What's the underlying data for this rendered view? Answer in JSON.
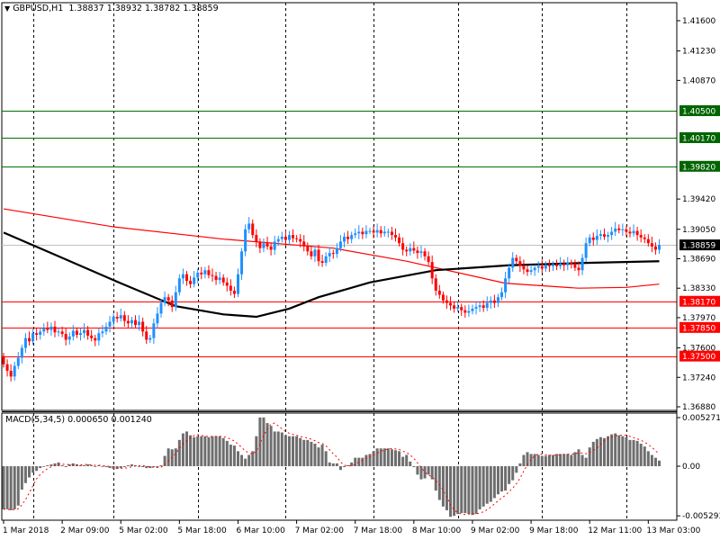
{
  "header": {
    "symbol": "GBPUSD,H1",
    "open": "1.38837",
    "high": "1.38932",
    "low": "1.38782",
    "close": "1.38859"
  },
  "macd_header": {
    "label": "MACD(5,34,5)",
    "main": "0.000650",
    "signal": "0.001240"
  },
  "colors": {
    "bull": "#1E90FF",
    "bear": "#FF0000",
    "support": "#FF0000",
    "resistance": "#007000",
    "badge_green": "#006400",
    "ma_fast": "#000000",
    "ma_slow": "#FF0000",
    "macd_hist": "#6E6E6E",
    "macd_signal": "#FF0000",
    "current_line": "#C0C0C0"
  },
  "chart_data": [
    {
      "type": "candlestick",
      "title": "GBPUSD,H1",
      "ylim": [
        1.3688,
        1.4195
      ],
      "first_open": 1.375,
      "closes": [
        1.374,
        1.3732,
        1.3725,
        1.3738,
        1.3748,
        1.376,
        1.3772,
        1.3768,
        1.3778,
        1.3776,
        1.378,
        1.3784,
        1.3782,
        1.3786,
        1.3779,
        1.378,
        1.3777,
        1.377,
        1.3774,
        1.3781,
        1.3776,
        1.3778,
        1.3782,
        1.3775,
        1.3772,
        1.3769,
        1.3778,
        1.378,
        1.3786,
        1.3792,
        1.3798,
        1.3796,
        1.38,
        1.3793,
        1.379,
        1.3794,
        1.3788,
        1.3792,
        1.378,
        1.377,
        1.3772,
        1.379,
        1.3802,
        1.3815,
        1.3822,
        1.3818,
        1.381,
        1.3828,
        1.3845,
        1.385,
        1.3842,
        1.3838,
        1.3846,
        1.3852,
        1.385,
        1.3855,
        1.3849,
        1.3848,
        1.3843,
        1.3846,
        1.384,
        1.3836,
        1.383,
        1.3826,
        1.385,
        1.3878,
        1.3905,
        1.3912,
        1.3898,
        1.389,
        1.3882,
        1.3888,
        1.3884,
        1.388,
        1.389,
        1.3893,
        1.3896,
        1.3892,
        1.3898,
        1.3894,
        1.3893,
        1.389,
        1.3884,
        1.3878,
        1.3872,
        1.388,
        1.3866,
        1.3864,
        1.3872,
        1.3876,
        1.3875,
        1.3882,
        1.389,
        1.3896,
        1.3893,
        1.3898,
        1.39,
        1.3902,
        1.3899,
        1.3903,
        1.3903,
        1.3901,
        1.3904,
        1.39,
        1.3902,
        1.3902,
        1.3898,
        1.3895,
        1.3888,
        1.388,
        1.3878,
        1.3882,
        1.3879,
        1.3876,
        1.3878,
        1.3872,
        1.3865,
        1.3845,
        1.383,
        1.3825,
        1.3818,
        1.3815,
        1.3812,
        1.3808,
        1.381,
        1.3806,
        1.3803,
        1.3805,
        1.3808,
        1.381,
        1.3812,
        1.3809,
        1.3815,
        1.3818,
        1.3815,
        1.3822,
        1.3828,
        1.3845,
        1.3858,
        1.387,
        1.3866,
        1.386,
        1.3856,
        1.3853,
        1.3855,
        1.3858,
        1.386,
        1.3857,
        1.3861,
        1.386,
        1.3862,
        1.386,
        1.3863,
        1.3861,
        1.3864,
        1.3862,
        1.3858,
        1.3855,
        1.387,
        1.3888,
        1.3895,
        1.3892,
        1.3897,
        1.3899,
        1.3896,
        1.3898,
        1.3902,
        1.3906,
        1.3904,
        1.3905,
        1.3902,
        1.39,
        1.3903,
        1.3898,
        1.3895,
        1.3893,
        1.3888,
        1.3884,
        1.388,
        1.38859
      ],
      "moving_averages": [
        {
          "name": "MA slow",
          "color": "#FF0000",
          "points": [
            [
              0,
              1.393
            ],
            [
              30,
              1.3908
            ],
            [
              60,
              1.3893
            ],
            [
              90,
              1.3882
            ],
            [
              110,
              1.3866
            ],
            [
              137,
              1.3839
            ],
            [
              157,
              1.3833
            ],
            [
              170,
              1.3834
            ],
            [
              179,
              1.3838
            ]
          ]
        },
        {
          "name": "MA fast",
          "color": "#000000",
          "points": [
            [
              0,
              1.3901
            ],
            [
              15,
              1.3872
            ],
            [
              32,
              1.3839
            ],
            [
              47,
              1.3811
            ],
            [
              60,
              1.3801
            ],
            [
              69,
              1.3798
            ],
            [
              78,
              1.3808
            ],
            [
              86,
              1.3822
            ],
            [
              100,
              1.384
            ],
            [
              118,
              1.3855
            ],
            [
              138,
              1.3861
            ],
            [
              160,
              1.3864
            ],
            [
              179,
              1.3866
            ]
          ]
        }
      ],
      "current_price": {
        "value": 1.38859,
        "label": "1.38859"
      },
      "levels": [
        {
          "value": 1.405,
          "label": "1.40500",
          "kind": "resistance"
        },
        {
          "value": 1.4017,
          "label": "1.40170",
          "kind": "resistance"
        },
        {
          "value": 1.3982,
          "label": "1.39820",
          "kind": "resistance"
        },
        {
          "value": 1.3817,
          "label": "1.38170",
          "kind": "support"
        },
        {
          "value": 1.3785,
          "label": "1.37850",
          "kind": "support"
        },
        {
          "value": 1.375,
          "label": "1.37500",
          "kind": "support"
        }
      ],
      "y_ticks": [
        {
          "value": 1.416,
          "label": "1.41600"
        },
        {
          "value": 1.4123,
          "label": "1.41230"
        },
        {
          "value": 1.4087,
          "label": "1.40870"
        },
        {
          "value": 1.3942,
          "label": "1.39420"
        },
        {
          "value": 1.3905,
          "label": "1.39050"
        },
        {
          "value": 1.3869,
          "label": "1.38690"
        },
        {
          "value": 1.3833,
          "label": "1.38330"
        },
        {
          "value": 1.3797,
          "label": "1.37970"
        },
        {
          "value": 1.376,
          "label": "1.37600"
        },
        {
          "value": 1.3724,
          "label": "1.37240"
        },
        {
          "value": 1.3688,
          "label": "1.36880"
        }
      ],
      "x_ticks": [
        {
          "index": 0,
          "label": "1 Mar 2018"
        },
        {
          "index": 16,
          "label": "2 Mar 09:00"
        },
        {
          "index": 32,
          "label": "5 Mar 02:00"
        },
        {
          "index": 48,
          "label": "5 Mar 18:00"
        },
        {
          "index": 64,
          "label": "6 Mar 10:00"
        },
        {
          "index": 80,
          "label": "7 Mar 02:00"
        },
        {
          "index": 96,
          "label": "7 Mar 18:00"
        },
        {
          "index": 112,
          "label": "8 Mar 10:00"
        },
        {
          "index": 128,
          "label": "9 Mar 02:00"
        },
        {
          "index": 144,
          "label": "9 Mar 18:00"
        },
        {
          "index": 160,
          "label": "12 Mar 11:00"
        },
        {
          "index": 176,
          "label": "13 Mar 03:00"
        }
      ],
      "grid_x_indices": [
        8,
        30,
        53,
        77,
        101,
        124,
        147,
        170
      ]
    },
    {
      "type": "bar",
      "title": "MACD(5,34,5)",
      "ylim": [
        -0.005293,
        0.005271
      ],
      "y_ticks": [
        {
          "value": 0.005271,
          "label": "0.005271"
        },
        {
          "value": 0,
          "label": "0.00"
        },
        {
          "value": -0.005293,
          "label": "-0.005293"
        }
      ],
      "signal_period": 5,
      "unit": 0.0001,
      "histogram": [
        -46,
        -46,
        -47,
        -46,
        -42,
        -25,
        -18,
        -12,
        -7,
        -5,
        -2,
        0,
        1,
        2,
        3,
        4,
        1,
        -1,
        2,
        3,
        2,
        1,
        1,
        2,
        1,
        0,
        1,
        0,
        -1,
        -2,
        -3,
        -3,
        -2,
        -1,
        1,
        2,
        1,
        0,
        -1,
        -2,
        -2,
        -1,
        -1,
        1,
        11,
        19,
        18,
        19,
        28,
        35,
        37,
        33,
        31,
        32,
        32,
        32,
        31,
        32,
        32,
        32,
        30,
        27,
        23,
        22,
        16,
        12,
        8,
        12,
        16,
        32,
        52,
        52,
        46,
        43,
        37,
        37,
        36,
        33,
        32,
        32,
        32,
        30,
        28,
        28,
        26,
        24,
        20,
        23,
        16,
        4,
        3,
        3,
        -4,
        -1,
        1,
        4,
        9,
        9,
        9,
        12,
        13,
        16,
        19,
        19,
        19,
        19,
        18,
        17,
        16,
        10,
        12,
        5,
        -1,
        -9,
        -14,
        -13,
        -9,
        -14,
        -26,
        -36,
        -43,
        -47,
        -54,
        -53,
        -51,
        -50,
        -50,
        -51,
        -52,
        -51,
        -46,
        -43,
        -40,
        -38,
        -34,
        -30,
        -27,
        -26,
        -19,
        -15,
        -7,
        3,
        12,
        15,
        13,
        13,
        12,
        11,
        11,
        12,
        12,
        13,
        13,
        13,
        13,
        12,
        15,
        18,
        12,
        9,
        20,
        26,
        29,
        31,
        30,
        32,
        34,
        35,
        33,
        32,
        31,
        28,
        28,
        27,
        24,
        21,
        16,
        12,
        9,
        6
      ]
    }
  ]
}
